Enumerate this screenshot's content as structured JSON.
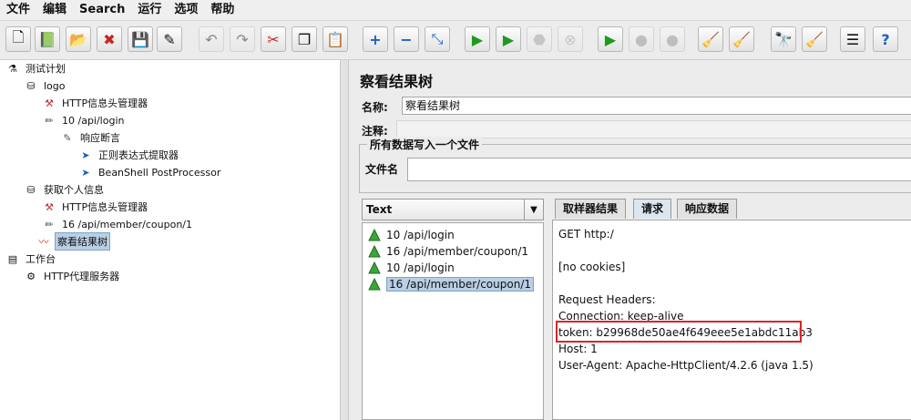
{
  "menu": [
    "文件",
    "编辑",
    "Search",
    "运行",
    "选项",
    "帮助"
  ],
  "toolbar_icons": [
    "new-icon",
    "templates-icon",
    "open-icon",
    "close-icon",
    "save-icon",
    "save-as-icon",
    "undo-icon",
    "redo-icon",
    "cut-icon",
    "copy-icon",
    "paste-icon",
    "expand-icon",
    "collapse-icon",
    "toggle-icon",
    "start-icon",
    "start-no-pause-icon",
    "stop-icon",
    "shutdown-icon",
    "remote-start-icon",
    "remote-stop-icon",
    "remote-exit-icon",
    "clear-icon",
    "clear-all-icon",
    "search-icon",
    "reset-search-icon",
    "function-helper-icon",
    "help-icon"
  ],
  "tree": [
    {
      "label": "测试计划",
      "icon": "test-plan-icon"
    },
    {
      "label": "logo",
      "icon": "thread-group-icon"
    },
    {
      "label": "HTTP信息头管理器",
      "icon": "header-manager-icon"
    },
    {
      "label": "10 /api/login",
      "icon": "sampler-icon"
    },
    {
      "label": "响应断言",
      "icon": "assertion-icon"
    },
    {
      "label": "正则表达式提取器",
      "icon": "extractor-icon"
    },
    {
      "label": "BeanShell PostProcessor",
      "icon": "postprocessor-icon"
    },
    {
      "label": "获取个人信息",
      "icon": "thread-group-icon"
    },
    {
      "label": "HTTP信息头管理器",
      "icon": "header-manager-icon"
    },
    {
      "label": "16 /api/member/coupon/1",
      "icon": "sampler-icon"
    },
    {
      "label": "察看结果树",
      "icon": "listener-icon"
    },
    {
      "label": "工作台",
      "icon": "workbench-icon"
    },
    {
      "label": "HTTP代理服务器",
      "icon": "proxy-icon"
    }
  ],
  "panel": {
    "title": "察看结果树",
    "name_label": "名称:",
    "name_value": "察看结果树",
    "comment_label": "注释:",
    "group_title": "所有数据写入一个文件",
    "file_label": "文件名",
    "render_select": "Text"
  },
  "results": [
    {
      "label": "10 /api/login"
    },
    {
      "label": "16 /api/member/coupon/1"
    },
    {
      "label": "10 /api/login"
    },
    {
      "label": "16 /api/member/coupon/1"
    }
  ],
  "tabs": [
    "取样器结果",
    "请求",
    "响应数据"
  ],
  "request_lines": [
    "GET http:/",
    "",
    "[no cookies]",
    "",
    "Request Headers:",
    "Connection: keep-alive",
    "token: b29968de50ae4f649eee5e1abdc11ab3",
    "Host: 1",
    "User-Agent: Apache-HttpClient/4.2.6 (java 1.5)"
  ],
  "colors": {
    "highlight_box": "#d9252a",
    "selection": "#b8cfe5",
    "success_icon": "#3aa53a"
  }
}
